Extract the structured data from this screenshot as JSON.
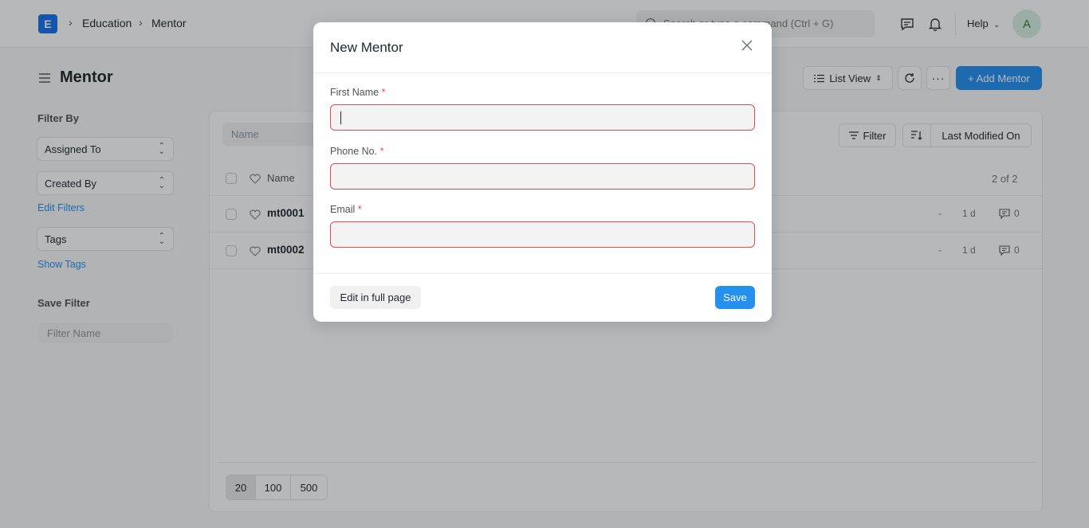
{
  "navbar": {
    "logo": "E",
    "breadcrumbs": [
      "Education",
      "Mentor"
    ],
    "search_placeholder": "Search or type a command (Ctrl + G)",
    "help_label": "Help",
    "avatar_initial": "A"
  },
  "page": {
    "title": "Mentor",
    "list_view_label": "List View",
    "add_button_label": "+ Add Mentor"
  },
  "sidebar": {
    "filter_by_label": "Filter By",
    "assigned_to": "Assigned To",
    "created_by": "Created By",
    "edit_filters": "Edit Filters",
    "tags": "Tags",
    "show_tags": "Show Tags",
    "save_filter_label": "Save Filter",
    "filter_name_placeholder": "Filter Name"
  },
  "list": {
    "name_filter_placeholder": "Name",
    "filter_button": "Filter",
    "sort_label": "Last Modified On",
    "column_name": "Name",
    "count": "2 of 2",
    "rows": [
      {
        "name": "mt0001",
        "dash": "-",
        "age": "1 d",
        "comments": "0"
      },
      {
        "name": "mt0002",
        "dash": "-",
        "age": "1 d",
        "comments": "0"
      }
    ],
    "page_sizes": [
      "20",
      "100",
      "500"
    ]
  },
  "modal": {
    "title": "New Mentor",
    "fields": [
      {
        "label": "First Name",
        "required_mark": "*",
        "value": ""
      },
      {
        "label": "Phone No.",
        "required_mark": "*",
        "value": ""
      },
      {
        "label": "Email",
        "required_mark": "*",
        "value": ""
      }
    ],
    "edit_full_page_label": "Edit in full page",
    "save_label": "Save"
  },
  "colors": {
    "primary": "#2490ef",
    "error_border": "#e24c4c",
    "overlay": "rgba(14,20,28,0.3)"
  }
}
